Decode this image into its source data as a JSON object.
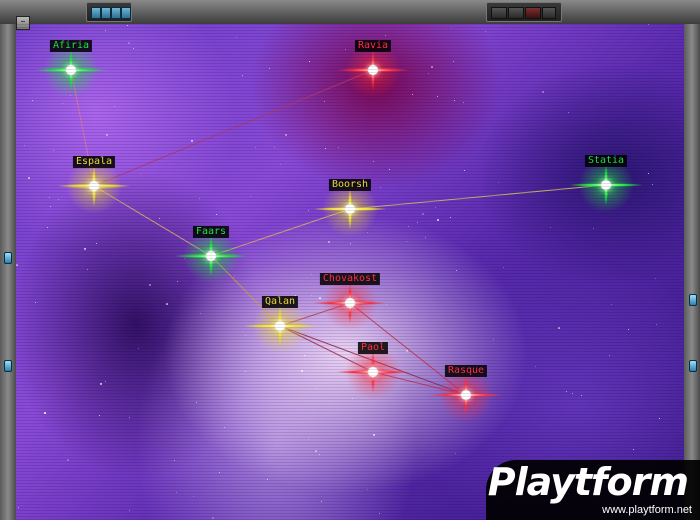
{
  "window": {
    "minimize_glyph": "–"
  },
  "colors": {
    "green": "#1fe840",
    "red": "#ff3344",
    "yellow": "#f0e030",
    "pink": "#ff6ae0"
  },
  "systems": [
    {
      "id": "afiria",
      "name": "Afiria",
      "color": "green"
    },
    {
      "id": "ravia",
      "name": "Ravia",
      "color": "red"
    },
    {
      "id": "espala",
      "name": "Espala",
      "color": "yellow"
    },
    {
      "id": "boorsh",
      "name": "Boorsh",
      "color": "yellow"
    },
    {
      "id": "statia",
      "name": "Statia",
      "color": "green"
    },
    {
      "id": "faars",
      "name": "Faars",
      "color": "green"
    },
    {
      "id": "chovakost",
      "name": "Chovakost",
      "color": "red"
    },
    {
      "id": "qalan",
      "name": "Qalan",
      "color": "yellow"
    },
    {
      "id": "paol",
      "name": "Paol",
      "color": "red"
    },
    {
      "id": "rasque",
      "name": "Rasque",
      "color": "red"
    }
  ],
  "routes": [
    {
      "from": "afiria",
      "to": "espala",
      "color": "#e07a9a"
    },
    {
      "from": "espala",
      "to": "faars",
      "color": "#e0b06a"
    },
    {
      "from": "espala",
      "to": "ravia",
      "color": "#b03a6a"
    },
    {
      "from": "faars",
      "to": "qalan",
      "color": "#d0a050"
    },
    {
      "from": "faars",
      "to": "boorsh",
      "color": "#e0b06a"
    },
    {
      "from": "boorsh",
      "to": "statia",
      "color": "#d0c060"
    },
    {
      "from": "qalan",
      "to": "chovakost",
      "color": "#c0404a"
    },
    {
      "from": "qalan",
      "to": "paol",
      "color": "#a03050"
    },
    {
      "from": "chovakost",
      "to": "rasque",
      "color": "#c03050"
    },
    {
      "from": "paol",
      "to": "rasque",
      "color": "#c03050"
    },
    {
      "from": "qalan",
      "to": "rasque",
      "color": "#902848"
    }
  ],
  "watermark": {
    "logo": "Playtform",
    "url": "www.playtform.net"
  }
}
